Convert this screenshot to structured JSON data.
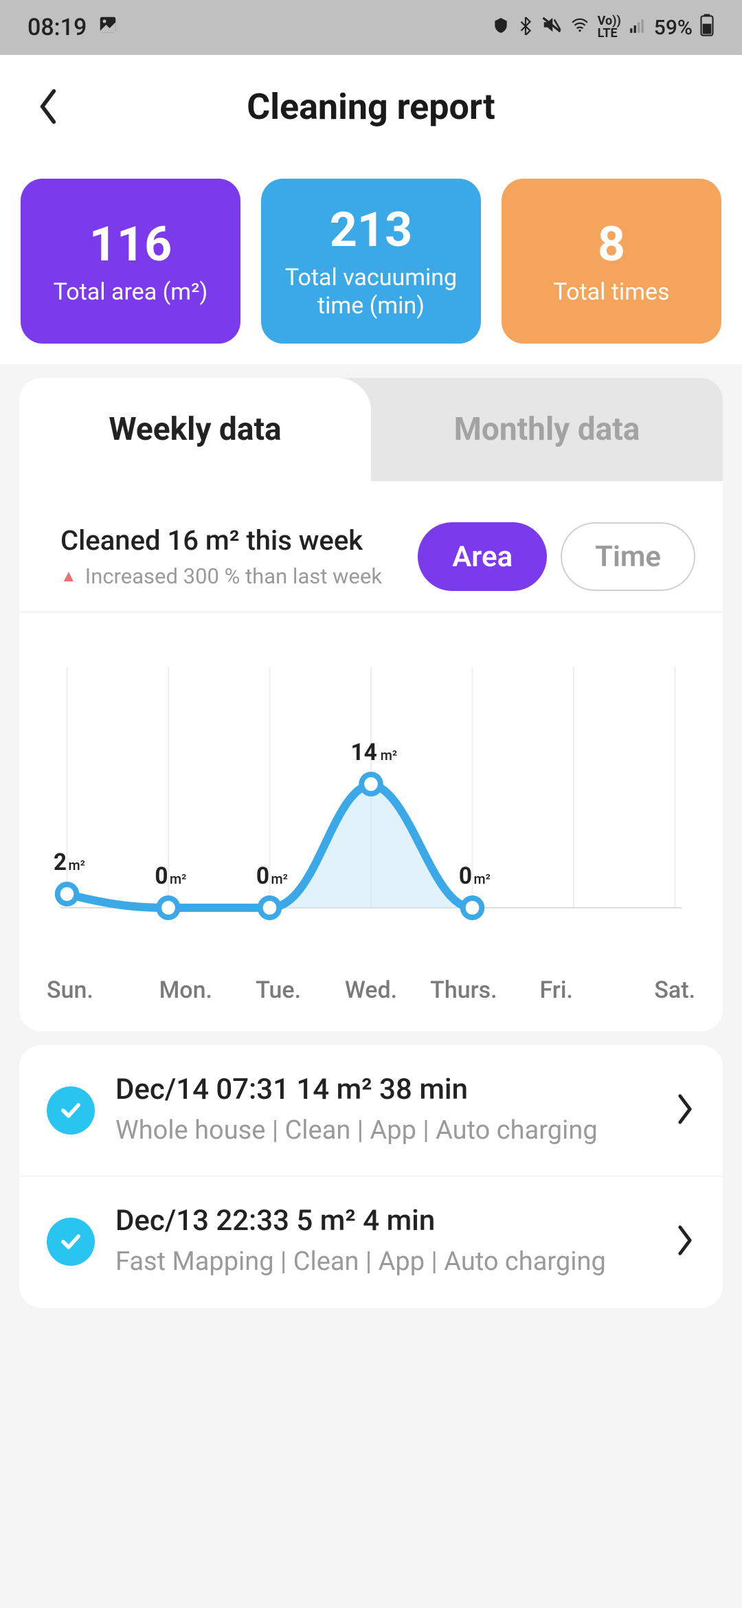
{
  "status_bar": {
    "time": "08:19",
    "battery": "59%"
  },
  "header": {
    "title": "Cleaning report"
  },
  "stats": {
    "area": {
      "value": "116",
      "label": "Total area (m²)"
    },
    "time": {
      "value": "213",
      "label": "Total vacuuming time (min)"
    },
    "count": {
      "value": "8",
      "label": "Total times"
    }
  },
  "tabs": {
    "weekly": "Weekly data",
    "monthly": "Monthly data"
  },
  "summary": {
    "title": "Cleaned 16 m² this week",
    "subtitle": "Increased 300 % than last week"
  },
  "toggle": {
    "area": "Area",
    "time": "Time"
  },
  "chart_data": {
    "type": "line",
    "title": "Cleaned 16 m² this week",
    "xlabel": "",
    "ylabel": "m²",
    "ylim": [
      0,
      14
    ],
    "categories": [
      "Sun.",
      "Mon.",
      "Tue.",
      "Wed.",
      "Thurs.",
      "Fri.",
      "Sat."
    ],
    "values": [
      2,
      0,
      0,
      14,
      0,
      null,
      null
    ],
    "unit": "m²"
  },
  "history": [
    {
      "title": "Dec/14 07:31 14 m² 38 min",
      "subtitle": "Whole house | Clean | App | Auto charging"
    },
    {
      "title": "Dec/13 22:33 5 m² 4 min",
      "subtitle": "Fast Mapping | Clean | App | Auto charging"
    }
  ]
}
